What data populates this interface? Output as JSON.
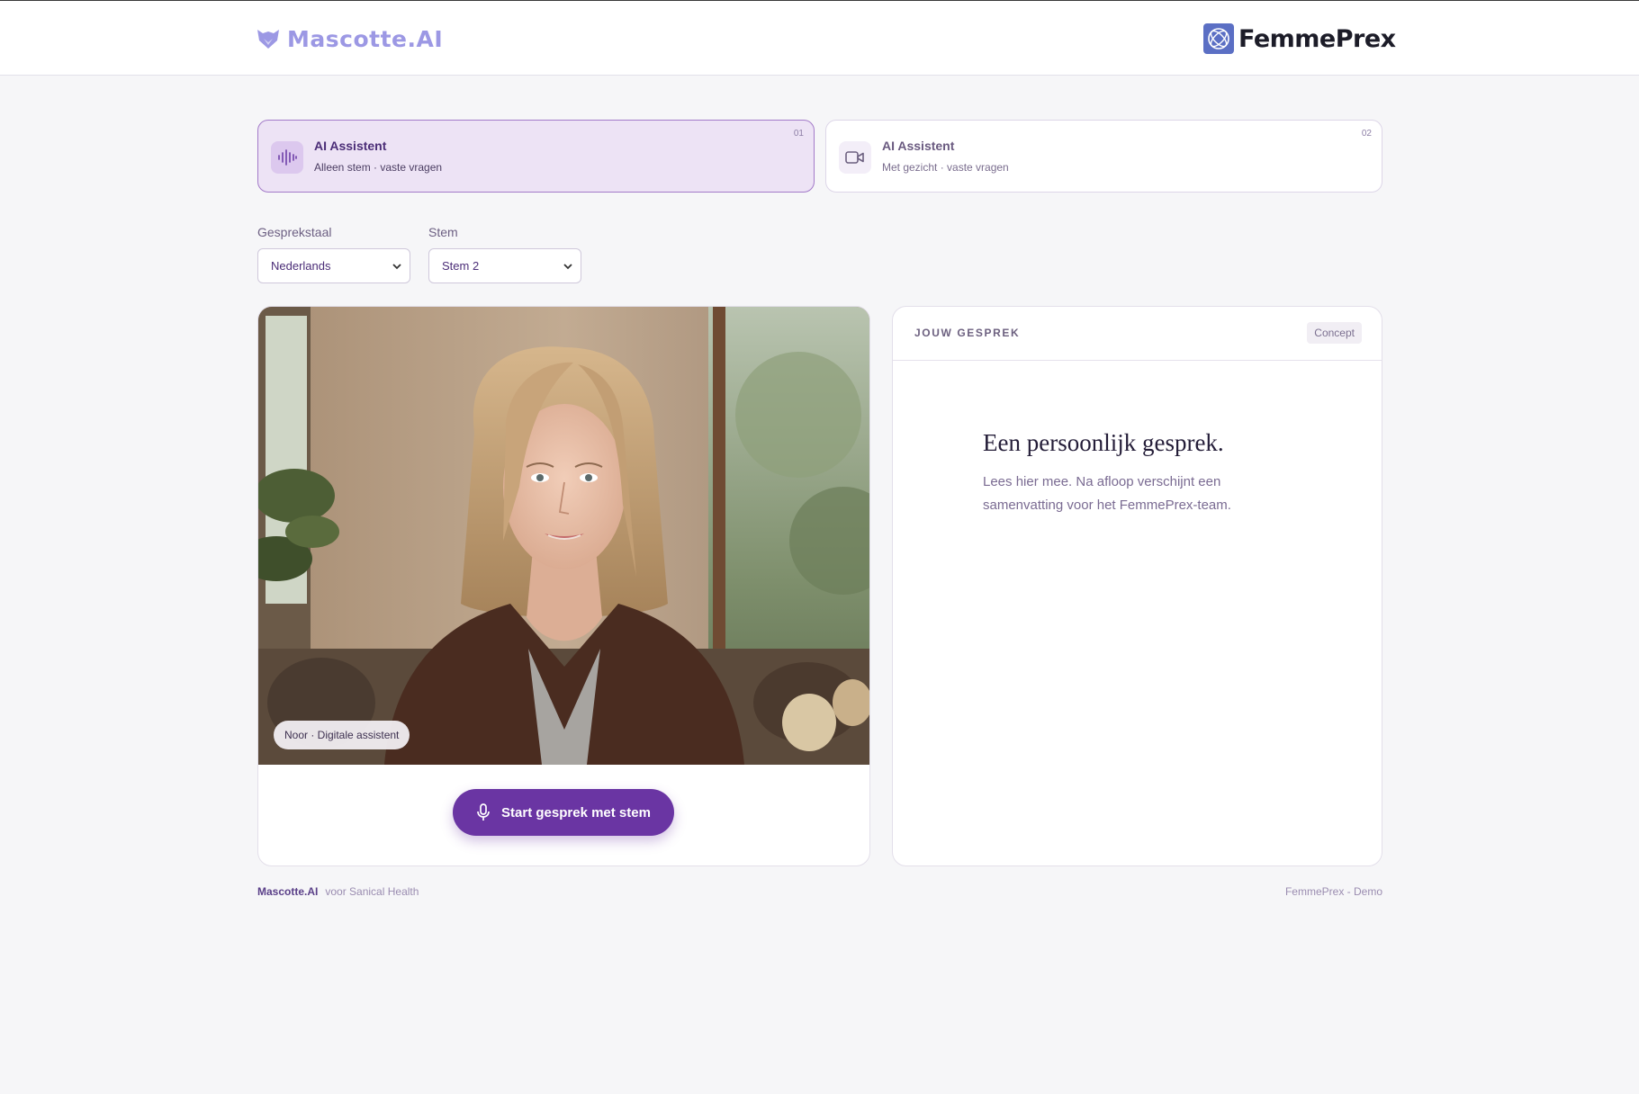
{
  "header": {
    "brand_left": "Mascotte.AI",
    "brand_right": "FemmePrex"
  },
  "modes": [
    {
      "title": "AI Assistent",
      "subtitle": "Alleen stem · vaste vragen",
      "number": "01",
      "icon": "waveform-icon",
      "active": true
    },
    {
      "title": "AI Assistent",
      "subtitle": "Met gezicht · vaste vragen",
      "number": "02",
      "icon": "video-camera-icon",
      "active": false
    }
  ],
  "settings": {
    "language_label": "Gesprekstaal",
    "language_value": "Nederlands",
    "voice_label": "Stem",
    "voice_value": "Stem 2"
  },
  "video": {
    "name_badge": "Noor · Digitale assistent",
    "start_button": "Start gesprek met stem"
  },
  "conversation": {
    "header_label": "JOUW GESPREK",
    "badge": "Concept",
    "title": "Een persoonlijk gesprek.",
    "body": "Lees hier mee. Na afloop verschijnt een samenvatting voor het FemmePrex-team."
  },
  "footer": {
    "brand": "Mascotte.AI",
    "tagline": "voor Sanical Health",
    "right": "FemmePrex - Demo"
  },
  "colors": {
    "accent": "#6a35a3",
    "active_card_bg": "#ede3f5",
    "page_bg": "#f6f6f8",
    "brand_left": "#9c98e4"
  }
}
